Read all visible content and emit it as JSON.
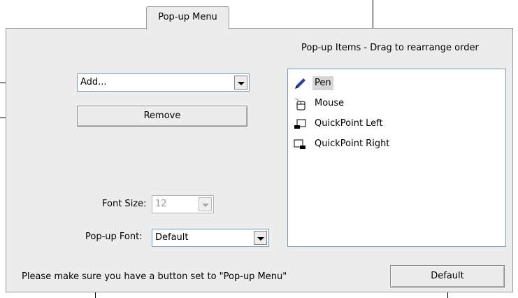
{
  "tab": {
    "label": "Pop-up Menu"
  },
  "left": {
    "add_select": {
      "value": "Add..."
    },
    "remove_button": "Remove",
    "font_size": {
      "label": "Font Size:",
      "value": "12"
    },
    "popup_font": {
      "label": "Pop-up Font:",
      "value": "Default"
    }
  },
  "right": {
    "heading": "Pop-up Items - Drag to rearrange order",
    "items": [
      {
        "label": "Pen",
        "icon": "pen-icon",
        "selected": true
      },
      {
        "label": "Mouse",
        "icon": "mouse-icon",
        "selected": false
      },
      {
        "label": "QuickPoint Left",
        "icon": "quickpoint-left-icon",
        "selected": false
      },
      {
        "label": "QuickPoint Right",
        "icon": "quickpoint-right-icon",
        "selected": false
      }
    ]
  },
  "footer": {
    "note": "Please make sure you have a button set to \"Pop-up Menu\"",
    "default_button": "Default"
  }
}
